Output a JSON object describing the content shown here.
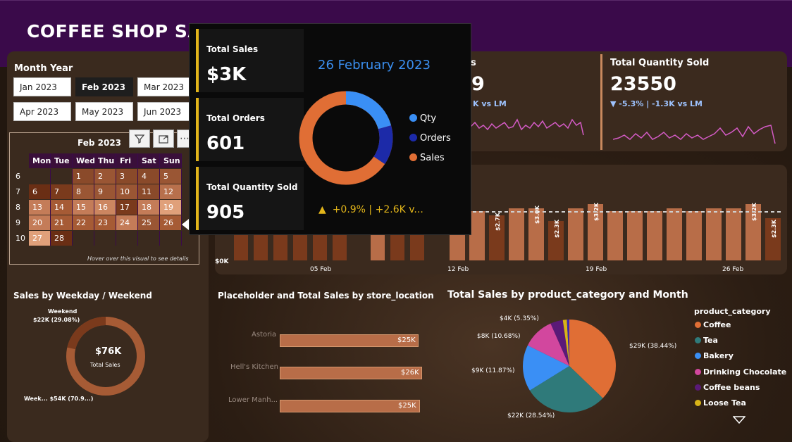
{
  "title": "COFFEE SHOP SA",
  "month_filter": {
    "label": "Month Year",
    "months": [
      "Jan 2023",
      "Feb 2023",
      "Mar 2023",
      "Apr 2023",
      "May 2023",
      "Jun 2023"
    ],
    "selected": "Feb 2023"
  },
  "calendar": {
    "title": "Feb 2023",
    "days": [
      "Mon",
      "Tue",
      "Wed",
      "Thu",
      "Fri",
      "Sat",
      "Sun"
    ],
    "weeks": [
      {
        "wk": "6",
        "cells": [
          "",
          "",
          "1",
          "2",
          "3",
          "4",
          "5"
        ]
      },
      {
        "wk": "7",
        "cells": [
          "6",
          "7",
          "8",
          "9",
          "10",
          "11",
          "12"
        ]
      },
      {
        "wk": "8",
        "cells": [
          "13",
          "14",
          "15",
          "16",
          "17",
          "18",
          "19"
        ]
      },
      {
        "wk": "9",
        "cells": [
          "20",
          "21",
          "22",
          "23",
          "24",
          "25",
          "26"
        ]
      },
      {
        "wk": "10",
        "cells": [
          "27",
          "28",
          "",
          "",
          "",
          "",
          ""
        ]
      }
    ],
    "note": "Hover over this visual to see details"
  },
  "tooltip": {
    "total_sales_label": "Total Sales",
    "total_sales_value": "$3K",
    "total_orders_label": "Total Orders",
    "total_orders_value": "601",
    "total_qty_label": "Total Quantity Sold",
    "total_qty_value": "905",
    "date": "26 February 2023",
    "legend": [
      {
        "name": "Qty",
        "color": "#3a8ff5"
      },
      {
        "name": "Orders",
        "color": "#1c2aa8"
      },
      {
        "name": "Sales",
        "color": "#e06e35"
      }
    ],
    "delta": "+0.9% | +2.6K v..."
  },
  "kpis": {
    "orders_fragment": {
      "title": "s",
      "value": "9",
      "delta": "K vs LM"
    },
    "qty": {
      "title": "Total Quantity Sold",
      "value": "23550",
      "delta": "▼ -5.3% | -1.3K vs LM"
    }
  },
  "daily": {
    "y_zero": "$0K",
    "x_ticks": [
      "05 Feb",
      "12 Feb",
      "19 Feb",
      "26 Feb"
    ],
    "bar_labels": [
      "$2.7K",
      "$3.0K",
      "$2.3K",
      "$3.2K",
      "$3.2K",
      "$2.3K"
    ]
  },
  "weekday": {
    "title": "Sales by Weekday / Weekend",
    "center_value": "$76K",
    "center_label": "Total Sales",
    "weekend_name": "Weekend",
    "weekend_value": "$22K (29.08%)",
    "weekday_value": "Week... $54K (70.9...)"
  },
  "store": {
    "title": "Placeholder and Total Sales by store_location",
    "rows": [
      {
        "name": "Astoria",
        "value": "$25K"
      },
      {
        "name": "Hell's Kitchen",
        "value": "$26K"
      },
      {
        "name": "Lower Manh...",
        "value": "$25K"
      }
    ]
  },
  "pie": {
    "title": "Total Sales by product_category and Month",
    "legend_title": "product_category",
    "labels": {
      "coffee": "$29K (38.44%)",
      "tea": "$22K (28.54%)",
      "bakery": "$9K (11.87%)",
      "choc": "$8K (10.68%)",
      "beans": "$4K (5.35%)"
    },
    "legend": [
      {
        "name": "Coffee",
        "color": "#e06e35"
      },
      {
        "name": "Tea",
        "color": "#2f7a7a"
      },
      {
        "name": "Bakery",
        "color": "#3a8ff5"
      },
      {
        "name": "Drinking Chocolate",
        "color": "#d2479e"
      },
      {
        "name": "Coffee beans",
        "color": "#5a1a78"
      },
      {
        "name": "Loose Tea",
        "color": "#d8b418"
      }
    ]
  }
}
